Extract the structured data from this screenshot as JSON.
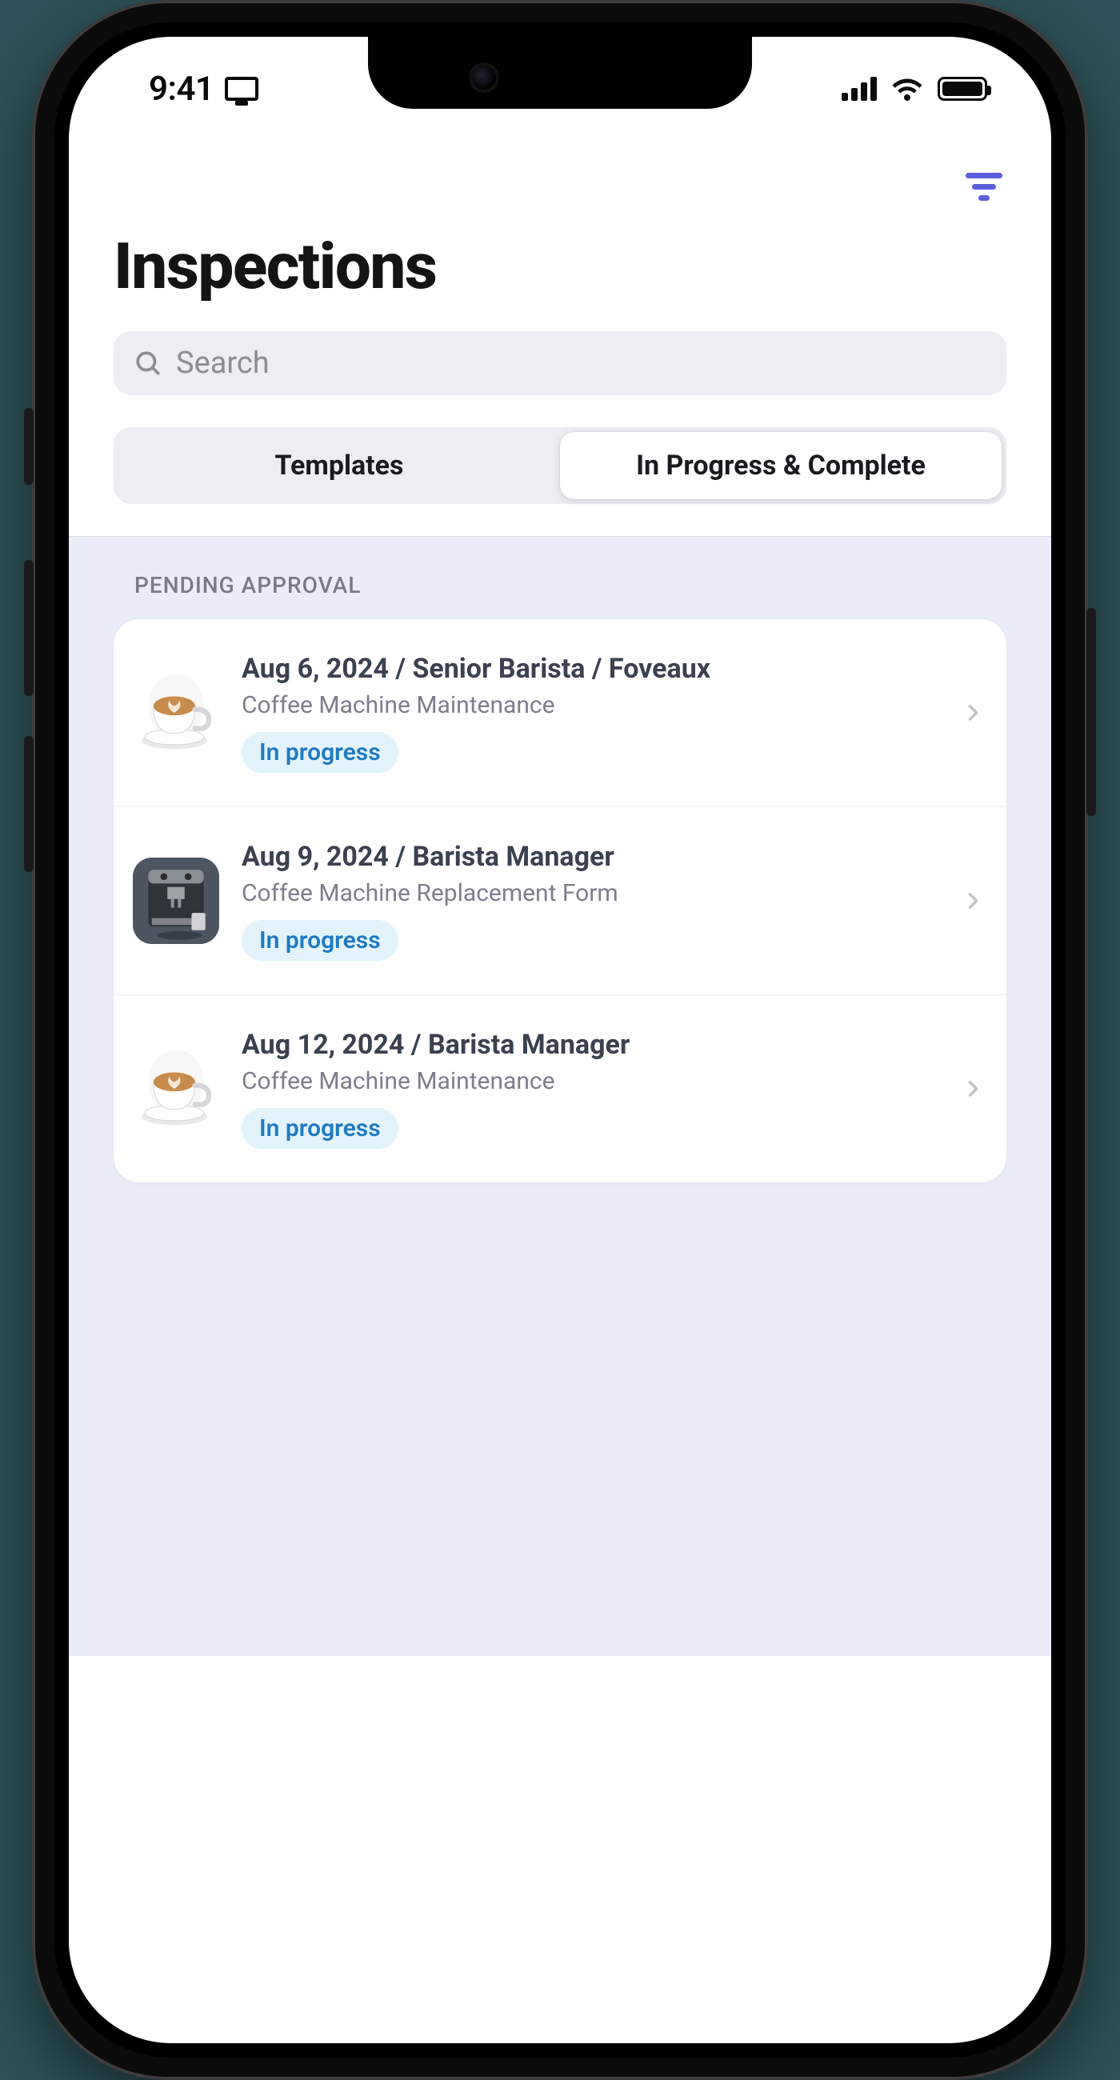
{
  "status": {
    "time": "9:41"
  },
  "header": {
    "title": "Inspections"
  },
  "search": {
    "placeholder": "Search",
    "value": ""
  },
  "tabs": {
    "templates": "Templates",
    "in_progress": "In Progress & Complete",
    "active": "in_progress"
  },
  "section": {
    "pending_label": "PENDING APPROVAL"
  },
  "items": [
    {
      "title": "Aug 6, 2024 / Senior Barista / Foveaux",
      "subtitle": "Coffee Machine Maintenance",
      "status": "In progress",
      "thumb": "cup"
    },
    {
      "title": "Aug 9, 2024 / Barista Manager",
      "subtitle": "Coffee Machine Replacement Form",
      "status": "In progress",
      "thumb": "machine"
    },
    {
      "title": "Aug 12, 2024 / Barista Manager",
      "subtitle": "Coffee Machine Maintenance",
      "status": "In progress",
      "thumb": "cup"
    }
  ],
  "colors": {
    "accent": "#5b5fdd",
    "badge_bg": "#e2f3fb",
    "badge_fg": "#1f79c2"
  }
}
